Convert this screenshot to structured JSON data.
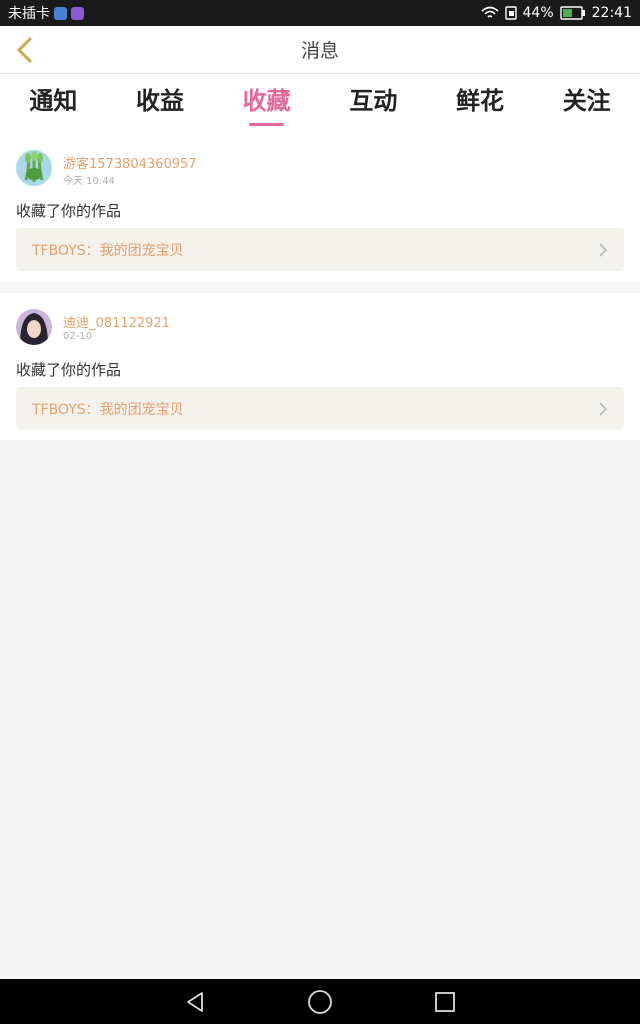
{
  "status_bar": {
    "carrier": "未插卡",
    "battery": "44%",
    "time": "22:41"
  },
  "header": {
    "title": "消息",
    "back_icon": "chevron-left-icon"
  },
  "tabs": [
    {
      "label": "通知",
      "active": false
    },
    {
      "label": "收益",
      "active": false
    },
    {
      "label": "收藏",
      "active": true
    },
    {
      "label": "互动",
      "active": false
    },
    {
      "label": "鲜花",
      "active": false
    },
    {
      "label": "关注",
      "active": false
    }
  ],
  "messages": [
    {
      "username": "游客1573804360957",
      "time": "今天 10:44",
      "action": "收藏了你的作品",
      "work_title": "TFBOYS：我的团宠宝贝"
    },
    {
      "username": "迪迪_081122921",
      "time": "02-10",
      "action": "收藏了你的作品",
      "work_title": "TFBOYS：我的团宠宝贝"
    }
  ],
  "colors": {
    "accent_pink": "#e8679a",
    "username_orange": "#e8a06b",
    "link_bg": "#f3f2ec"
  }
}
